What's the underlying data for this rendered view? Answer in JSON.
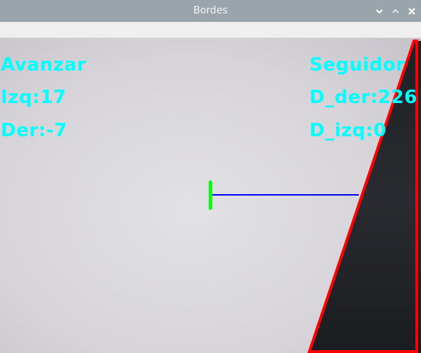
{
  "window": {
    "title": "Bordes",
    "buttons": {
      "minimize_icon": "chevron-down-icon",
      "maximize_icon": "chevron-up-icon",
      "close_icon": "close-icon"
    }
  },
  "overlay": {
    "left": {
      "mode": "Avanzar",
      "izq": "Izq:17",
      "der": "Der:-7"
    },
    "right": {
      "mode": "Seguidor",
      "d_der": "D_der:226",
      "d_izq": "D_izq:0"
    }
  },
  "colors": {
    "overlay_text": "#00ffff",
    "center_marker": "#00ff00",
    "distance_line": "#0000ff",
    "edge_outline": "#ff0000",
    "titlebar": "#9aa4ab"
  }
}
